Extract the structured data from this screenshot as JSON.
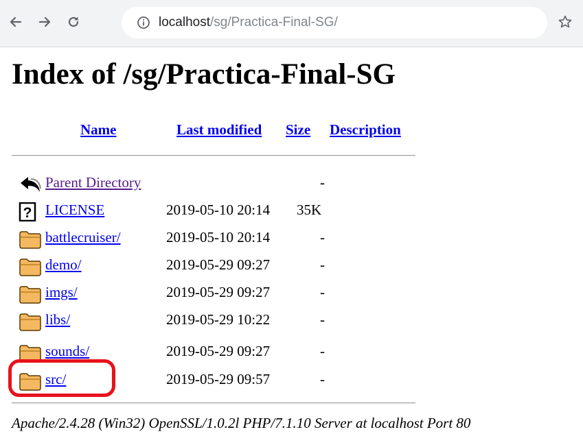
{
  "browser": {
    "url_host": "localhost",
    "url_path": "/sg/Practica-Final-SG/"
  },
  "page": {
    "title": "Index of /sg/Practica-Final-SG"
  },
  "table": {
    "headers": {
      "name": "Name",
      "last_modified": "Last modified",
      "size": "Size",
      "description": "Description"
    },
    "rows": [
      {
        "icon": "back-arrow-icon",
        "name": "Parent Directory",
        "modified": "",
        "size": "-"
      },
      {
        "icon": "unknown-file-icon",
        "name": "LICENSE",
        "modified": "2019-05-10 20:14",
        "size": "35K"
      },
      {
        "icon": "folder-icon",
        "name": "battlecruiser/",
        "modified": "2019-05-10 20:14",
        "size": "-"
      },
      {
        "icon": "folder-icon",
        "name": "demo/",
        "modified": "2019-05-29 09:27",
        "size": "-"
      },
      {
        "icon": "folder-icon",
        "name": "imgs/",
        "modified": "2019-05-29 09:27",
        "size": "-"
      },
      {
        "icon": "folder-icon",
        "name": "libs/",
        "modified": "2019-05-29 10:22",
        "size": "-"
      },
      {
        "icon": "folder-icon",
        "name": "sounds/",
        "modified": "2019-05-29 09:27",
        "size": "-"
      },
      {
        "icon": "folder-icon",
        "name": "src/",
        "modified": "2019-05-29 09:57",
        "size": "-"
      }
    ]
  },
  "footer": {
    "text": "Apache/2.4.28 (Win32) OpenSSL/1.0.2l PHP/7.1.10 Server at localhost Port 80"
  },
  "colors": {
    "link": "#0000ee",
    "visited_link": "#551a8b",
    "annotation_red": "#e8121b",
    "toolbar_bg": "#f1f3f4"
  }
}
